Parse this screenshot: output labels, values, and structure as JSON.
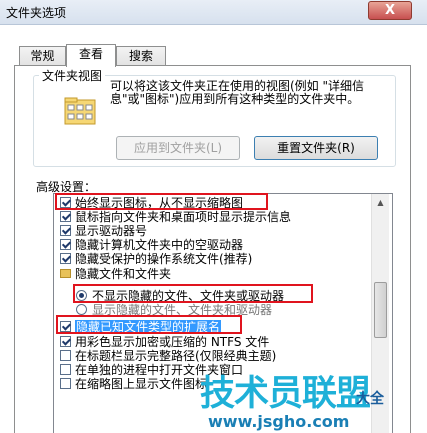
{
  "window": {
    "title": "文件夹选项",
    "close_glyph": "X"
  },
  "tabs": [
    {
      "label": "常规",
      "active": false
    },
    {
      "label": "查看",
      "active": true
    },
    {
      "label": "搜索",
      "active": false
    }
  ],
  "folder_views": {
    "group_label": "文件夹视图",
    "description": "可以将这该文件夹正在使用的视图(例如 \"详细信息\"或\"图标\")应用到所有这种类型的文件夹中。",
    "apply_button": "应用到文件夹(L)",
    "reset_button": "重置文件夹(R)"
  },
  "advanced": {
    "label": "高级设置：",
    "items": [
      {
        "type": "checkbox",
        "checked": true,
        "text": "始终显示图标，从不显示缩略图"
      },
      {
        "type": "checkbox",
        "checked": true,
        "text": "鼠标指向文件夹和桌面项时显示提示信息"
      },
      {
        "type": "checkbox",
        "checked": true,
        "text": "显示驱动器号"
      },
      {
        "type": "checkbox",
        "checked": true,
        "text": "隐藏计算机文件夹中的空驱动器"
      },
      {
        "type": "checkbox",
        "checked": true,
        "text": "隐藏受保护的操作系统文件(推荐)"
      },
      {
        "type": "folder",
        "text": "隐藏文件和文件夹"
      },
      {
        "type": "radio",
        "checked": true,
        "text": "不显示隐藏的文件、文件夹或驱动器"
      },
      {
        "type": "radio",
        "checked": false,
        "text": "显示隐藏的文件、文件夹和驱动器"
      },
      {
        "type": "checkbox",
        "checked": true,
        "text": "隐藏已知文件类型的扩展名",
        "selected": true
      },
      {
        "type": "checkbox",
        "checked": true,
        "text": "用彩色显示加密或压缩的 NTFS 文件"
      },
      {
        "type": "checkbox",
        "checked": false,
        "text": "在标题栏显示完整路径(仅限经典主题)"
      },
      {
        "type": "checkbox",
        "checked": false,
        "text": "在单独的进程中打开文件夹窗口"
      },
      {
        "type": "checkbox",
        "checked": false,
        "text": "在缩略图上显示文件图标"
      }
    ]
  },
  "watermark": {
    "main": "技术员联盟",
    "sub": "大全",
    "url": "www.jsgho.com"
  },
  "colors": {
    "highlight_box": "#e0141e",
    "selection": "#3399ff"
  }
}
